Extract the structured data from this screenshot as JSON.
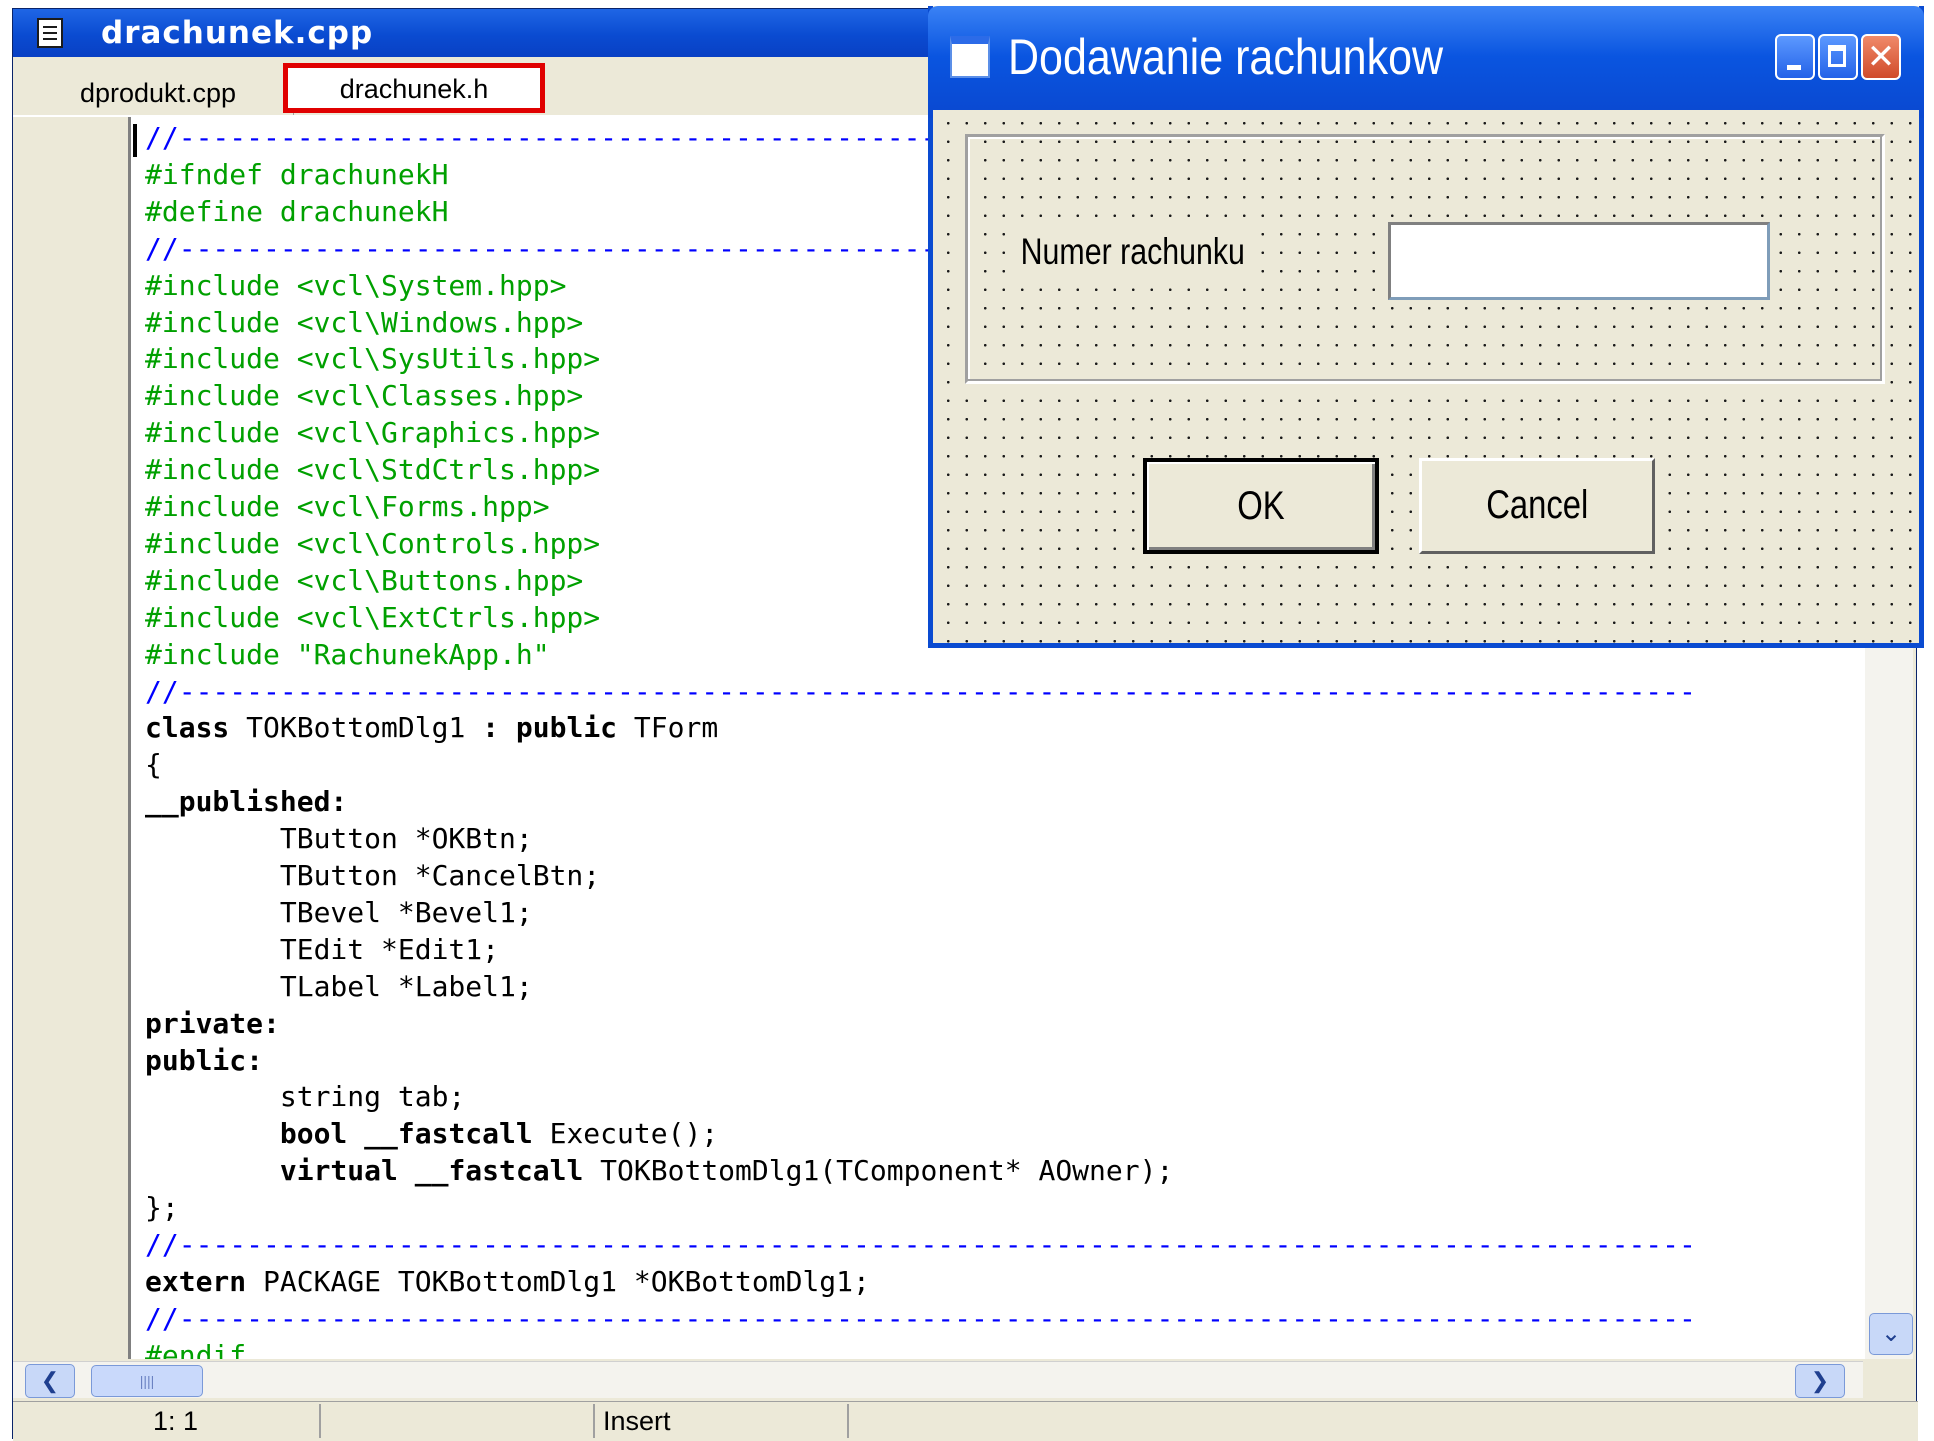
{
  "editor": {
    "title": "drachunek.cpp",
    "tabs": [
      {
        "label": "dprodukt.cpp"
      },
      {
        "label": "drachunek.h"
      }
    ],
    "code_lines": [
      {
        "text": "//------------------------------------------------------------------------------------------",
        "kind": "comment"
      },
      {
        "text": "#ifndef drachunekH",
        "kind": "pre"
      },
      {
        "text": "#define drachunekH",
        "kind": "pre"
      },
      {
        "text": "//------------------------------------------------------------------------------------------",
        "kind": "comment"
      },
      {
        "text": "#include <vcl\\System.hpp>",
        "kind": "pre"
      },
      {
        "text": "#include <vcl\\Windows.hpp>",
        "kind": "pre"
      },
      {
        "text": "#include <vcl\\SysUtils.hpp>",
        "kind": "pre"
      },
      {
        "text": "#include <vcl\\Classes.hpp>",
        "kind": "pre"
      },
      {
        "text": "#include <vcl\\Graphics.hpp>",
        "kind": "pre"
      },
      {
        "text": "#include <vcl\\StdCtrls.hpp>",
        "kind": "pre"
      },
      {
        "text": "#include <vcl\\Forms.hpp>",
        "kind": "pre"
      },
      {
        "text": "#include <vcl\\Controls.hpp>",
        "kind": "pre"
      },
      {
        "text": "#include <vcl\\Buttons.hpp>",
        "kind": "pre"
      },
      {
        "text": "#include <vcl\\ExtCtrls.hpp>",
        "kind": "pre"
      },
      {
        "text": "#include \"RachunekApp.h\"",
        "kind": "pre"
      },
      {
        "text": "//------------------------------------------------------------------------------------------",
        "kind": "comment"
      },
      {
        "parts": [
          {
            "t": "class",
            "b": true
          },
          {
            "t": " TOKBottomDlg1 "
          },
          {
            "t": ":",
            "b": true
          },
          {
            "t": " "
          },
          {
            "t": "public",
            "b": true
          },
          {
            "t": " TForm"
          }
        ]
      },
      {
        "text": "{"
      },
      {
        "text": "__published:",
        "kind": "kw"
      },
      {
        "text": "        TButton *OKBtn;"
      },
      {
        "text": "        TButton *CancelBtn;"
      },
      {
        "text": "        TBevel *Bevel1;"
      },
      {
        "text": "        TEdit *Edit1;"
      },
      {
        "text": "        TLabel *Label1;"
      },
      {
        "text": "private:",
        "kind": "kw"
      },
      {
        "text": "public:",
        "kind": "kw"
      },
      {
        "text": "        string tab;"
      },
      {
        "parts": [
          {
            "t": "        "
          },
          {
            "t": "bool",
            "b": true
          },
          {
            "t": " "
          },
          {
            "t": "__fastcall",
            "b": true
          },
          {
            "t": " Execute();"
          }
        ]
      },
      {
        "parts": [
          {
            "t": "        "
          },
          {
            "t": "virtual",
            "b": true
          },
          {
            "t": " "
          },
          {
            "t": "__fastcall",
            "b": true
          },
          {
            "t": " TOKBottomDlg1(TComponent* AOwner);"
          }
        ]
      },
      {
        "text": "};"
      },
      {
        "text": "//------------------------------------------------------------------------------------------",
        "kind": "comment"
      },
      {
        "parts": [
          {
            "t": "extern",
            "b": true
          },
          {
            "t": " PACKAGE TOKBottomDlg1 *OKBottomDlg1;"
          }
        ]
      },
      {
        "text": "//------------------------------------------------------------------------------------------",
        "kind": "comment"
      },
      {
        "text": "#endif",
        "kind": "pre"
      }
    ],
    "status": {
      "position": "1:  1",
      "mode": "Insert"
    },
    "scroll_icons": {
      "left": "chevron-left-icon",
      "right": "chevron-right-icon",
      "down": "chevron-down-icon"
    }
  },
  "dialog": {
    "title": "Dodawanie rachunkow",
    "label": "Numer rachunku",
    "input_value": "",
    "ok_label": "OK",
    "cancel_label": "Cancel"
  },
  "colors": {
    "comment": "#0000ff",
    "preprocessor": "#00a000",
    "titlebar": "#0a4bd1",
    "tab_highlight": "#e00000"
  }
}
